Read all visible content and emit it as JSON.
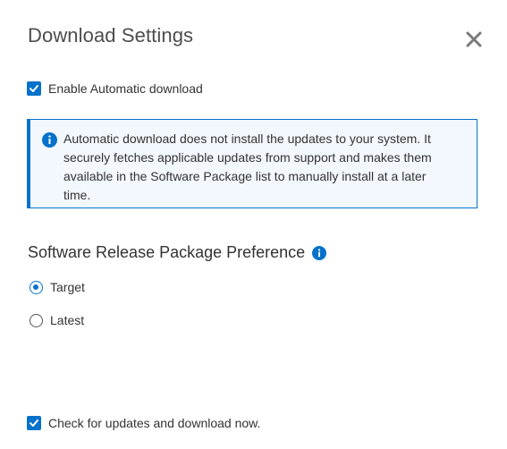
{
  "dialog": {
    "title": "Download Settings",
    "close_icon": "close-icon"
  },
  "auto_download": {
    "label": "Enable Automatic download",
    "checked": true
  },
  "info": {
    "icon": "info-icon",
    "message": "Automatic download does not install the updates to your system. It securely fetches applicable updates from support and makes them available in the Software Package list to manually install at a later time."
  },
  "preference": {
    "title": "Software Release Package Preference",
    "help_icon": "info-icon",
    "options": [
      {
        "label": "Target",
        "selected": true
      },
      {
        "label": "Latest",
        "selected": false
      }
    ]
  },
  "check_now": {
    "label": "Check for updates and download now.",
    "checked": true
  },
  "colors": {
    "accent": "#0672cb",
    "info_background": "#f2f8fd",
    "text": "#333333"
  }
}
